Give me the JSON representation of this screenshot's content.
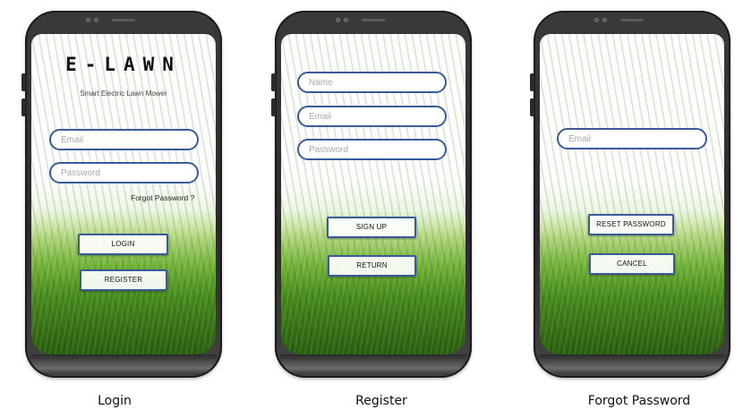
{
  "login": {
    "logo": "E-LAWN",
    "tagline": "Smart Electric Lawn Mower",
    "email_placeholder": "Email",
    "password_placeholder": "Password",
    "forgot_link": "Forgot Password ?",
    "login_button": "LOGIN",
    "register_button": "REGISTER",
    "caption": "Login"
  },
  "register": {
    "name_placeholder": "Name",
    "email_placeholder": "Email",
    "password_placeholder": "Password",
    "signup_button": "SIGN UP",
    "return_button": "RETURN",
    "caption": "Register"
  },
  "forgot": {
    "email_placeholder": "Email",
    "reset_button": "RESET PASSWORD",
    "cancel_button": "CANCEL",
    "caption": "Forgot Password"
  },
  "colors": {
    "field_border": "#3a5a9a",
    "grass": "#4f9a1f",
    "phone_body": "#2a2a2a"
  }
}
